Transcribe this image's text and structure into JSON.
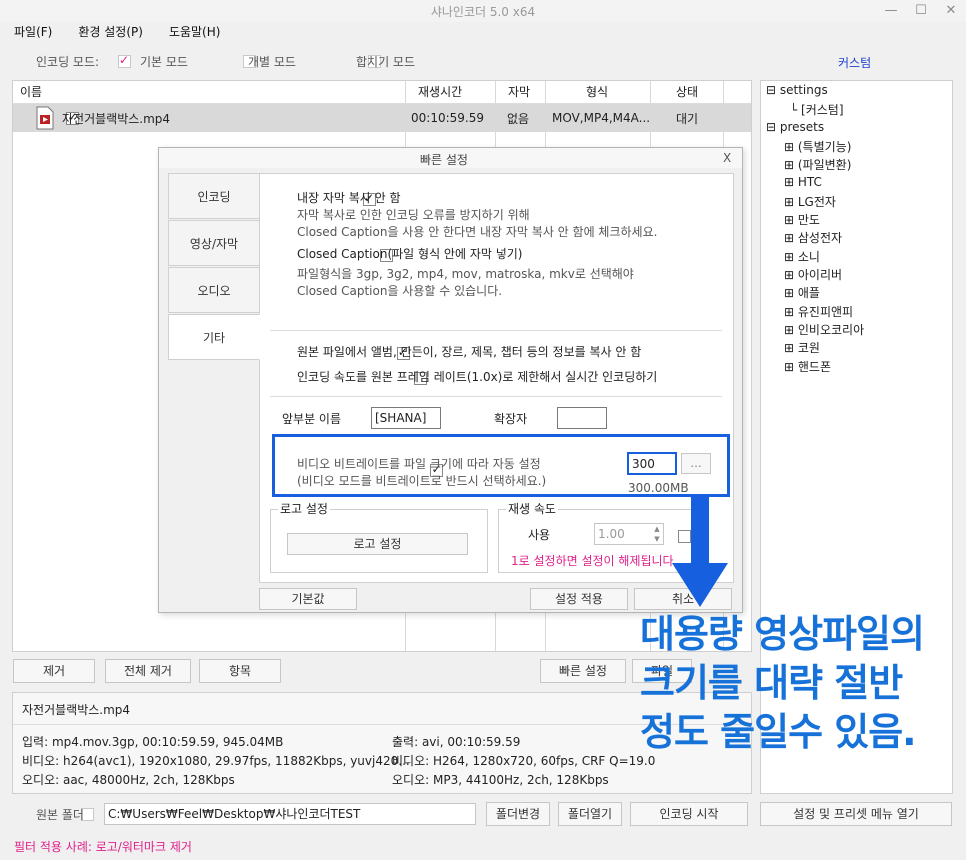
{
  "window": {
    "title": "샤나인코더  5.0  x64",
    "min": "—",
    "max": "☐",
    "close": "✕"
  },
  "menu": [
    "파일(F)",
    "환경 설정(P)",
    "도움말(H)"
  ],
  "modebar": {
    "label": "인코딩 모드:",
    "basic": "기본 모드",
    "individual": "개별 모드",
    "merge": "합치기 모드",
    "custom": "커스텀"
  },
  "filelist": {
    "columns": [
      "이름",
      "재생시간",
      "자막",
      "형식",
      "상태"
    ],
    "rows": [
      {
        "name": "자전거블랙박스.mp4",
        "duration": "00:10:59.59",
        "subtitle": "없음",
        "format": "MOV,MP4,M4A...",
        "status": "대기"
      }
    ]
  },
  "tree": {
    "settings": "settings",
    "custom": "[커스텀]",
    "presets": "presets",
    "items": [
      "(특별기능)",
      "(파일변환)",
      "HTC",
      "LG전자",
      "만도",
      "삼성전자",
      "소니",
      "아이리버",
      "애플",
      "유진피앤피",
      "인비오코리아",
      "코원",
      "핸드폰"
    ]
  },
  "dialog": {
    "title": "빠른 설정",
    "close": "X",
    "tabs": [
      "인코딩",
      "영상/자막",
      "오디오",
      "기타"
    ],
    "opt1": {
      "label": "내장 자막 복사 안 함",
      "desc1": "자막 복사로 인한 인코딩 오류를 방지하기 위해",
      "desc2": "Closed Caption을 사용 안 한다면 내장 자막 복사 안 함에 체크하세요."
    },
    "opt2": {
      "label": "Closed Caption(파일 형식 안에 자막 넣기)",
      "desc1": "파일형식을 3gp, 3g2, mp4, mov, matroska, mkv로 선택해야",
      "desc2": "Closed Caption을 사용할 수 있습니다."
    },
    "opt3": "원본 파일에서 앨범, 만든이, 장르, 제목, 챕터 등의 정보를 복사 안 함",
    "opt4": "인코딩 속도를 원본 프레임 레이트(1.0x)로 제한해서 실시간 인코딩하기",
    "prefix_label": "앞부분 이름",
    "prefix_value": "[SHANA]",
    "ext_label": "확장자",
    "ext_value": "",
    "bitrate": {
      "line1": "비디오 비트레이트를 파일 크기에 따라 자동 설정",
      "line2": "(비디오 모드를 비트레이트로 반드시 선택하세요.)",
      "value": "300",
      "browse": "...",
      "size": "300.00MB"
    },
    "logo": {
      "group": "로고 설정",
      "button": "로고 설정"
    },
    "speed": {
      "group": "재생 속도",
      "use": "사용",
      "value": "1.00",
      "warn": "1로 설정하면 설정이 해제됩니다."
    },
    "buttons": {
      "default": "기본값",
      "apply": "설정 적용",
      "cancel": "취소"
    }
  },
  "bottombuttons": {
    "remove": "제거",
    "remove_all": "전체 제거",
    "items": "항목",
    "quick": "빠른 설정",
    "extra": "파일"
  },
  "info": {
    "filename": "자전거블랙박스.mp4",
    "input": "입력: mp4.mov.3gp, 00:10:59.59, 945.04MB",
    "video_in": "비디오: h264(avc1), 1920x1080, 29.97fps, 11882Kbps,  yuvj420...",
    "audio_in": "오디오: aac, 48000Hz, 2ch, 128Kbps",
    "output": "출력: avi, 00:10:59.59",
    "video_out": "비디오: H264, 1280x720, 60fps, CRF Q=19.0",
    "audio_out": "오디오: MP3, 44100Hz, 2ch, 128Kbps"
  },
  "footer": {
    "source_folder": "원본 폴더",
    "path": "C:₩Users₩Feel₩Desktop₩샤나인코더TEST",
    "change_folder": "폴더변경",
    "open_folder": "폴더열기",
    "start": "인코딩 시작",
    "settings_menu": "설정 및 프리셋 메뉴 열기",
    "filter_note": "필터 적용 사례: 로고/워터마크 제거"
  },
  "overlay": {
    "line1": "대용량 영상파일의",
    "line2": "크기를 대략 절반",
    "line3": "정도 줄일수 있음."
  },
  "colors": {
    "accent_blue": "#1660e0",
    "pink": "#e0208a",
    "overlay_blue": "#1672d8"
  }
}
